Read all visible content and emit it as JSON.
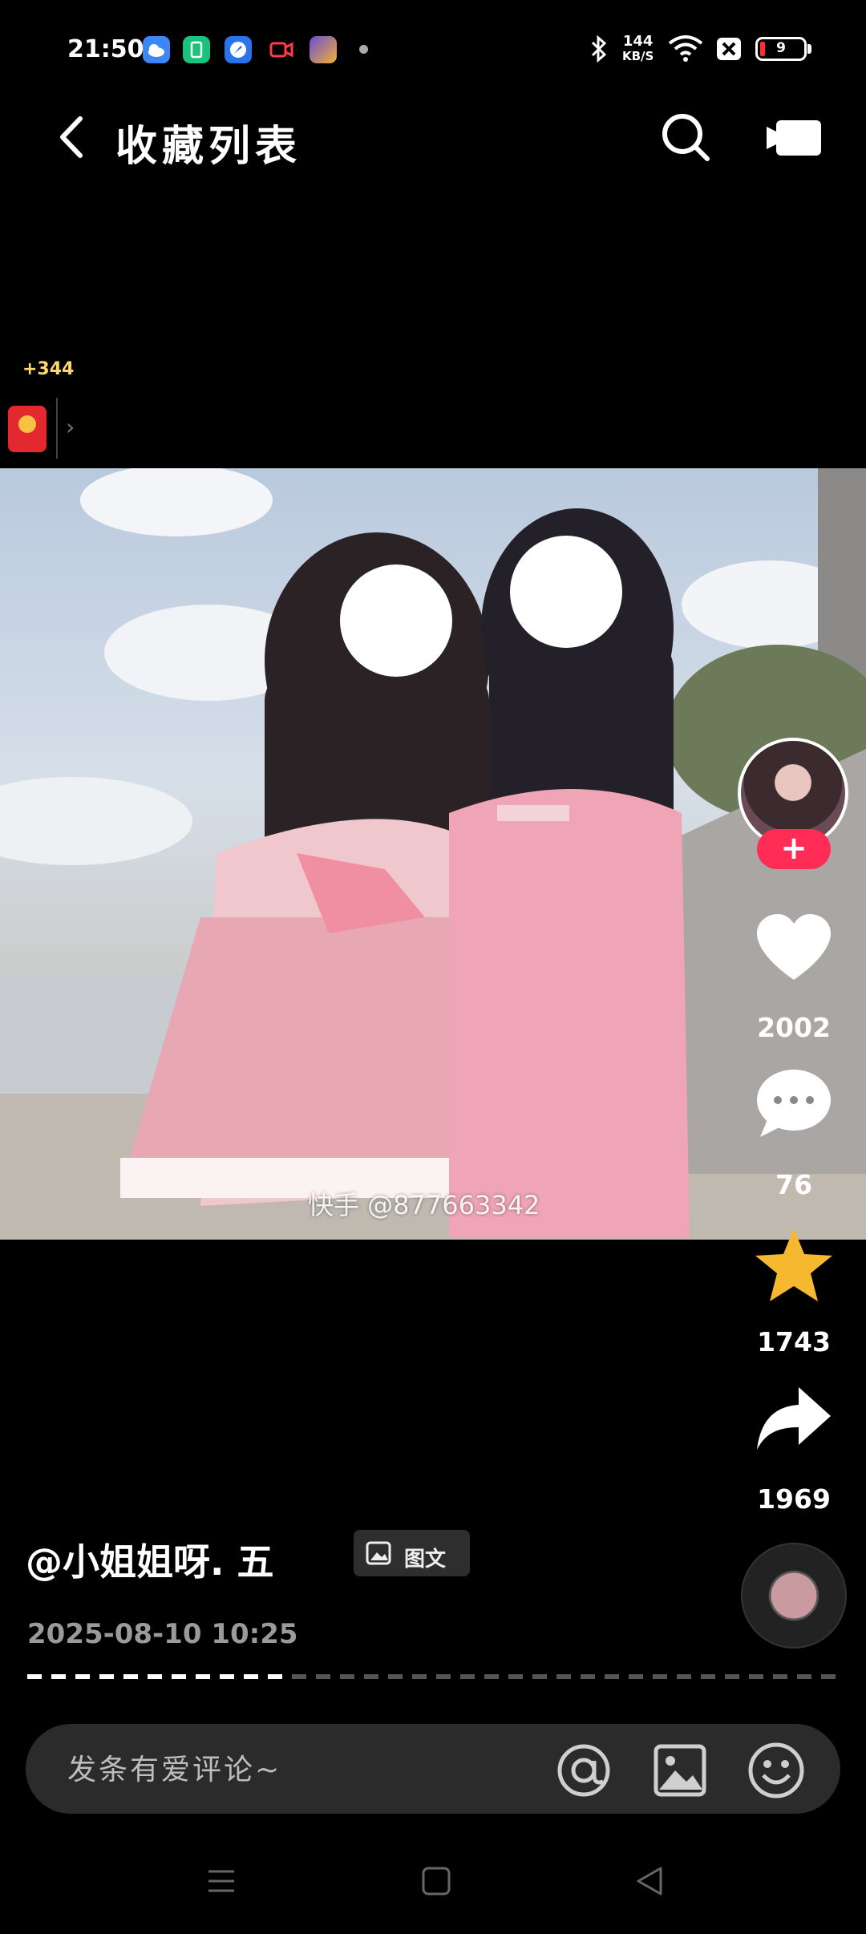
{
  "status_bar": {
    "time": "21:50",
    "net_speed_value": "144",
    "net_speed_unit": "KB/S",
    "battery_level": "9",
    "icons": [
      "weather-app-icon",
      "phone-manager-icon",
      "browser-icon",
      "screen-record-icon",
      "game-app-icon",
      "bluetooth-icon",
      "wifi-icon",
      "sim-off-icon",
      "battery-icon"
    ]
  },
  "header": {
    "title": "收藏列表",
    "back_icon": "back-arrow-icon",
    "search_icon": "search-icon",
    "camera_icon": "camera-icon"
  },
  "reward": {
    "bonus": "+344",
    "icon": "red-packet-icon"
  },
  "post": {
    "watermark": "快手 @877663342",
    "author": "@小姐姐呀. 五",
    "type_badge": "图文",
    "timestamp": "2025-08-10  10:25",
    "progress": 0.32
  },
  "actions": {
    "likes": "2002",
    "comments": "76",
    "favorites": "1743",
    "shares": "1969",
    "follow_label": "+"
  },
  "comment_bar": {
    "placeholder": "发条有爱评论~"
  },
  "colors": {
    "background": "#000000",
    "follow_button": "#ff2c55",
    "favorite_star": "#f5b82e",
    "bonus_text": "#ffd76a"
  }
}
